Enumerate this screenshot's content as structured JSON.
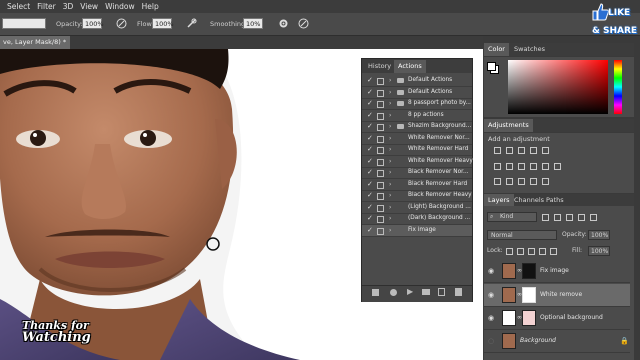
{
  "menu": [
    "Select",
    "Filter",
    "3D",
    "View",
    "Window",
    "Help"
  ],
  "options": {
    "opacity_label": "Opacity:",
    "opacity": "100%",
    "flow_label": "Flow:",
    "flow": "100%",
    "smoothing_label": "Smoothing:",
    "smoothing": "10%"
  },
  "document_tab": "ve, Layer Mask/8) *",
  "actions_panel": {
    "tabs": [
      "History",
      "Actions"
    ],
    "rows": [
      {
        "label": "Default Actions",
        "folder": true
      },
      {
        "label": "Default Actions",
        "folder": true
      },
      {
        "label": "8 passport photo by...",
        "folder": true
      },
      {
        "label": "8 pp actions",
        "folder": false
      },
      {
        "label": "Shazim Background...",
        "folder": true
      },
      {
        "label": "White Remover Nor...",
        "folder": false
      },
      {
        "label": "White Remover Hard",
        "folder": false
      },
      {
        "label": "White Remover Heavy",
        "folder": false
      },
      {
        "label": "Black Remover Nor...",
        "folder": false
      },
      {
        "label": "Black Remover Hard",
        "folder": false
      },
      {
        "label": "Black Remover Heavy",
        "folder": false
      },
      {
        "label": "(Light) Background ...",
        "folder": false
      },
      {
        "label": "(Dark) Background ...",
        "folder": false
      },
      {
        "label": "Fix image",
        "folder": false
      }
    ]
  },
  "color_panel": {
    "tabs": [
      "Color",
      "Swatches"
    ]
  },
  "adjustments": {
    "title": "Adjustments",
    "subtitle": "Add an adjustment"
  },
  "layers_panel": {
    "tabs": [
      "Layers",
      "Channels",
      "Paths"
    ],
    "kind": "Kind",
    "blend_mode": "Normal",
    "opacity_label": "Opacity:",
    "opacity": "100%",
    "lock_label": "Lock:",
    "fill_label": "Fill:",
    "fill": "100%",
    "layers": [
      "Fix image",
      "White remove",
      "Optional background",
      "Background"
    ]
  },
  "overlay": {
    "badge_line1": "LIKE",
    "badge_line2": "& SHARE",
    "thanks_line1": "Thanks for",
    "thanks_line2": "Watching"
  },
  "colors": {
    "accent": "#1f6fd1",
    "panel": "#4b4b4b",
    "canvas": "#f4f4f4"
  }
}
